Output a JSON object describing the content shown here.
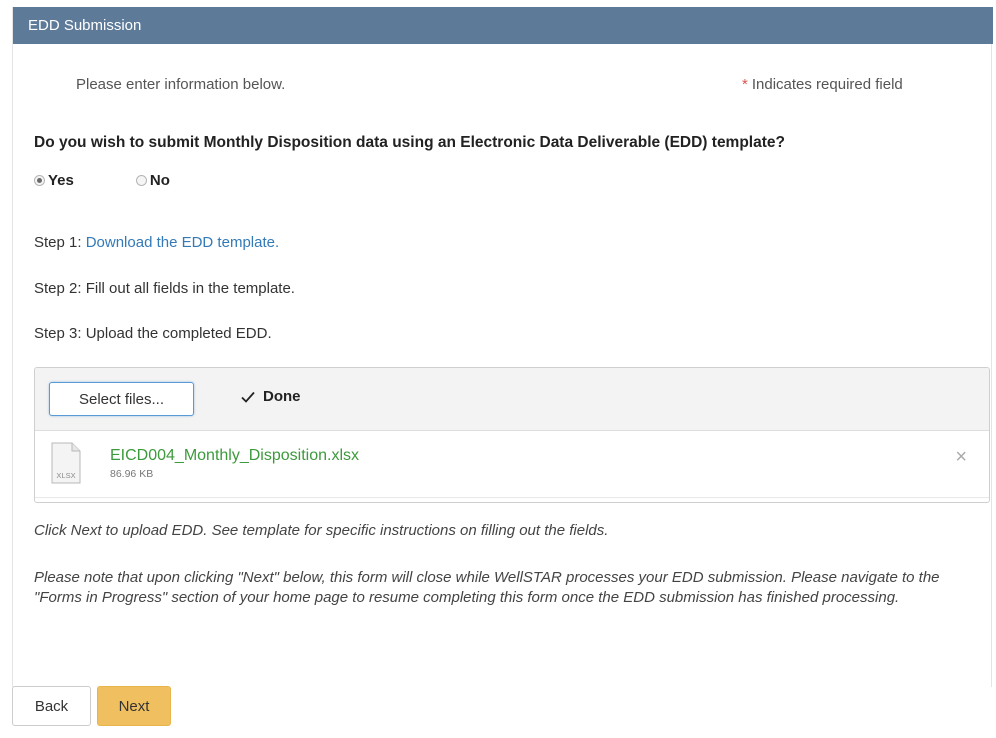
{
  "panel": {
    "title": "EDD Submission"
  },
  "intro": {
    "text": "Please enter information below.",
    "required_asterisk": "*",
    "required_note": "Indicates required field"
  },
  "question": {
    "text": "Do you wish to submit Monthly Disposition data using an Electronic Data Deliverable (EDD) template?",
    "options": [
      {
        "label": "Yes",
        "selected": true
      },
      {
        "label": "No",
        "selected": false
      }
    ]
  },
  "steps": {
    "step1_prefix": "Step 1: ",
    "step1_link": "Download the EDD template.",
    "step2": "Step 2: Fill out all fields in the template.",
    "step3": "Step 3: Upload the completed EDD."
  },
  "upload": {
    "select_label": "Select files...",
    "status": "Done",
    "file": {
      "icon_label": "XLSX",
      "name": "EICD004_Monthly_Disposition.xlsx",
      "size": "86.96 KB"
    },
    "remove_symbol": "×"
  },
  "notes": {
    "note1": "Click Next to upload EDD. See template for specific instructions on filling out the fields.",
    "note2": "Please note that upon clicking \"Next\" below, this form will close while WellSTAR processes your EDD submission. Please navigate to the \"Forms in Progress\" section of your home page to resume completing this form once the EDD submission has finished processing."
  },
  "footer": {
    "back_label": "Back",
    "next_label": "Next"
  },
  "colors": {
    "header_bg": "#5d7a99",
    "link": "#337ab7",
    "file_name": "#3c9a3c",
    "next_button": "#f0c060",
    "required_asterisk": "#d9534f"
  }
}
